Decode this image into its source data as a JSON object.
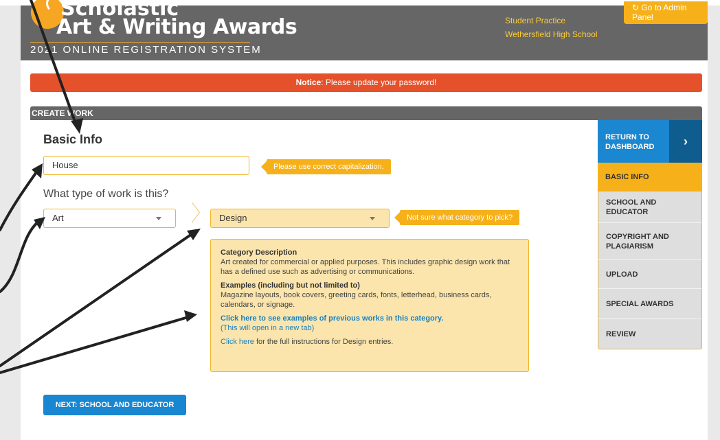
{
  "header": {
    "brand_line1": "Scholastic",
    "brand_line2": "Art & Writing Awards",
    "brand_line3": "2021 ONLINE REGISTRATION SYSTEM",
    "user_role": "Student Practice",
    "user_school": "Wethersfield High School",
    "admin_button": "Go to Admin Panel",
    "admin_icon": "refresh-icon"
  },
  "notice": {
    "prefix": "Notice",
    "message": ": Please update your password!"
  },
  "section": {
    "title": "CREATE WORK"
  },
  "form": {
    "heading": "Basic Info",
    "title_value": "House",
    "title_tip": "Please use correct capitalization.",
    "type_question": "What type of work is this?",
    "type_select": "Art",
    "category_select": "Design",
    "category_tip": "Not sure what category to pick?",
    "desc_title": "Category Description",
    "desc_text": "Art created for commercial or applied purposes. This includes graphic design work that has a defined use such as advertising or communications.",
    "examples_title": "Examples (including but not limited to)",
    "examples_text": "Magazine layouts, book covers, greeting cards, fonts, letterhead, business cards, calendars, or signage.",
    "examples_link": "Click here to see examples of previous works in this category.",
    "examples_link_note": "(This will open in a new tab)",
    "instructions_link": "Click here",
    "instructions_text": " for the full instructions for Design entries.",
    "next_button": "NEXT: SCHOOL AND EDUCATOR"
  },
  "sidebar": {
    "return_label": "RETURN TO DASHBOARD",
    "return_icon": "chevron-right-icon",
    "items": [
      {
        "label": "BASIC INFO",
        "active": true
      },
      {
        "label": "SCHOOL AND EDUCATOR",
        "active": false
      },
      {
        "label": "COPYRIGHT AND PLAGIARISM",
        "active": false
      },
      {
        "label": "UPLOAD",
        "active": false
      },
      {
        "label": "SPECIAL AWARDS",
        "active": false
      },
      {
        "label": "REVIEW",
        "active": false
      }
    ]
  },
  "colors": {
    "header_bg": "#666666",
    "accent": "#f6b11a",
    "notice": "#e5512b",
    "primary_button": "#1886d0",
    "annotation_arrow": "#222222"
  }
}
